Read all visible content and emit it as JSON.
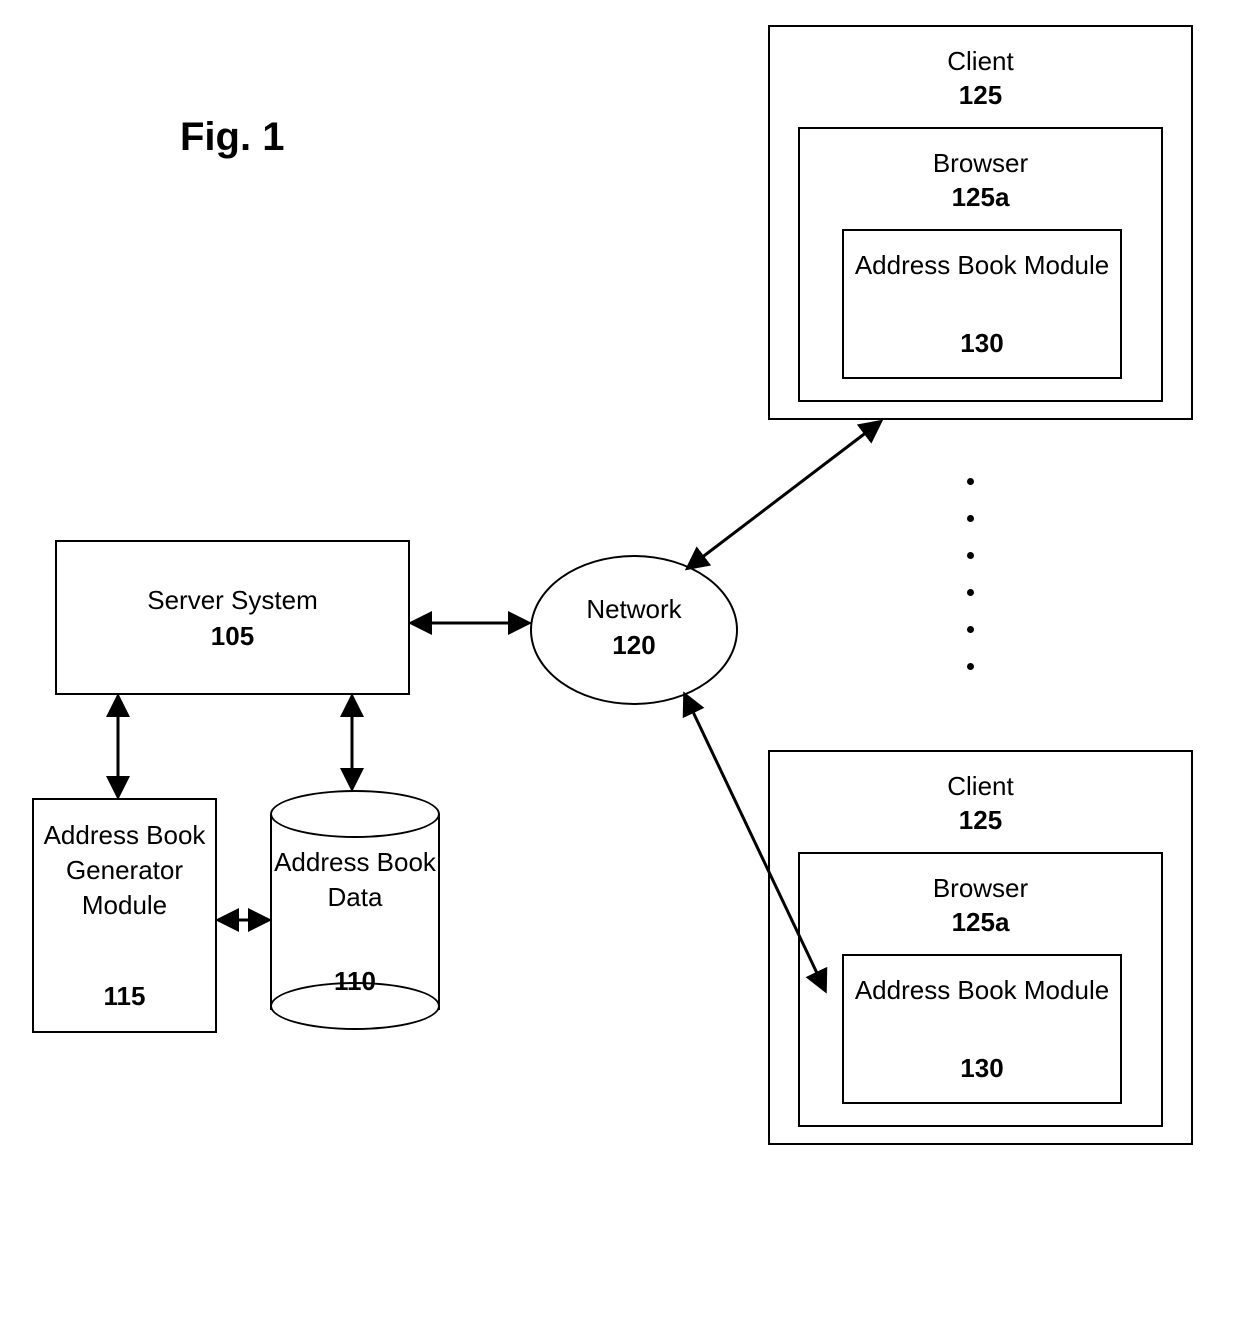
{
  "figure": {
    "title": "Fig. 1"
  },
  "nodes": {
    "server_system": {
      "label": "Server System",
      "ref": "105"
    },
    "abg_module": {
      "label": "Address Book Generator Module",
      "ref": "115"
    },
    "ab_data": {
      "label": "Address Book Data",
      "ref": "110"
    },
    "network": {
      "label": "Network",
      "ref": "120"
    },
    "client1": {
      "label": "Client",
      "ref": "125",
      "browser": {
        "label": "Browser",
        "ref": "125a",
        "ab_module": {
          "label": "Address Book Module",
          "ref": "130"
        }
      }
    },
    "client2": {
      "label": "Client",
      "ref": "125",
      "browser": {
        "label": "Browser",
        "ref": "125a",
        "ab_module": {
          "label": "Address Book Module",
          "ref": "130"
        }
      }
    }
  },
  "connections": [
    [
      "server_system",
      "network",
      "bidirectional"
    ],
    [
      "server_system",
      "abg_module",
      "bidirectional"
    ],
    [
      "server_system",
      "ab_data",
      "bidirectional"
    ],
    [
      "abg_module",
      "ab_data",
      "bidirectional"
    ],
    [
      "network",
      "client1",
      "bidirectional"
    ],
    [
      "network",
      "client2",
      "bidirectional"
    ]
  ]
}
